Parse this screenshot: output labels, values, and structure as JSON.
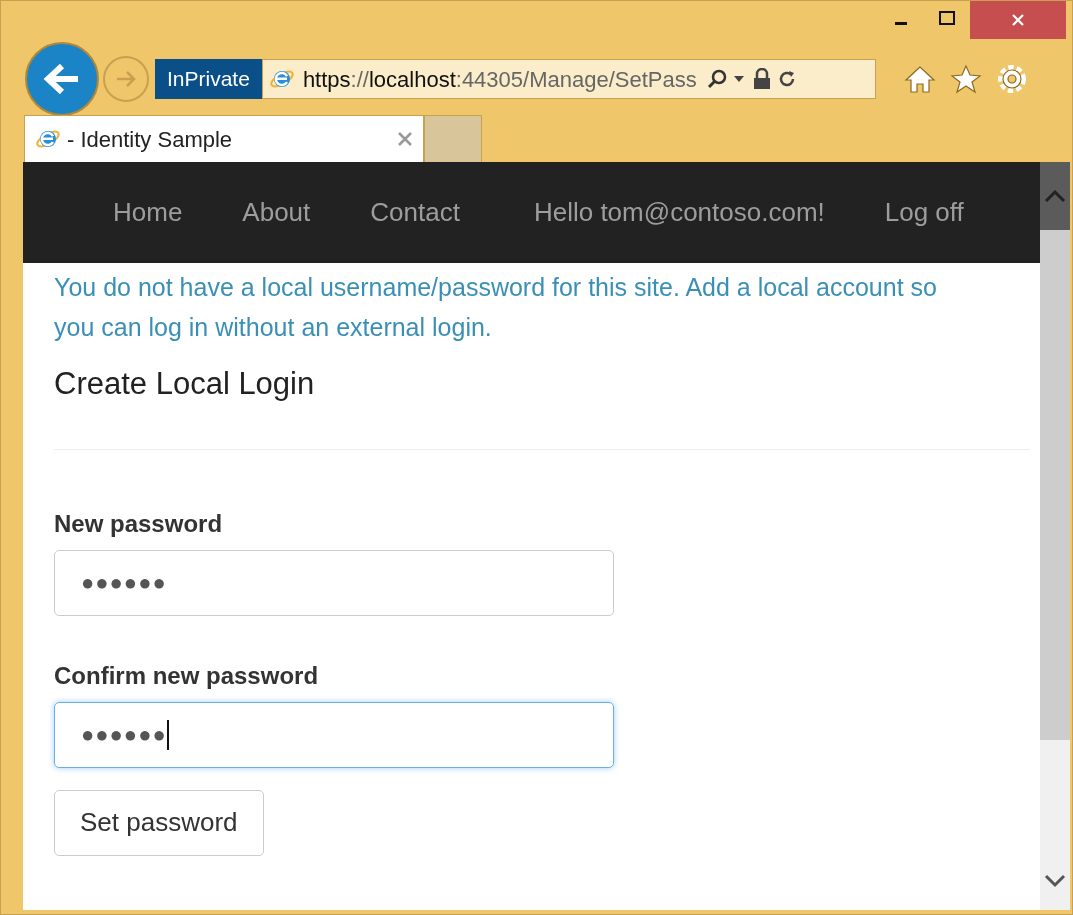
{
  "browser": {
    "inprivate": "InPrivate",
    "address": [
      {
        "text": "https",
        "emphasis": true
      },
      {
        "text": "://",
        "emphasis": false
      },
      {
        "text": "localhost",
        "emphasis": true
      },
      {
        "text": ":44305/Manage/SetPass",
        "emphasis": false
      }
    ],
    "tabs": [
      {
        "title": "- Identity Sample",
        "selected": true
      }
    ]
  },
  "navbar": {
    "items": [
      {
        "label": "Home"
      },
      {
        "label": "About"
      },
      {
        "label": "Contact"
      },
      {
        "label": "Hello tom@contoso.com!"
      },
      {
        "label": "Log off"
      }
    ]
  },
  "page": {
    "message": "You do not have a local username/password for this site. Add a local account so you can log in without an external login.",
    "heading": "Create Local Login",
    "fields": [
      {
        "label": "New password",
        "value": "●●●●●●",
        "focused": false
      },
      {
        "label": "Confirm new password",
        "value": "●●●●●●",
        "focused": true
      }
    ],
    "button": "Set password"
  }
}
